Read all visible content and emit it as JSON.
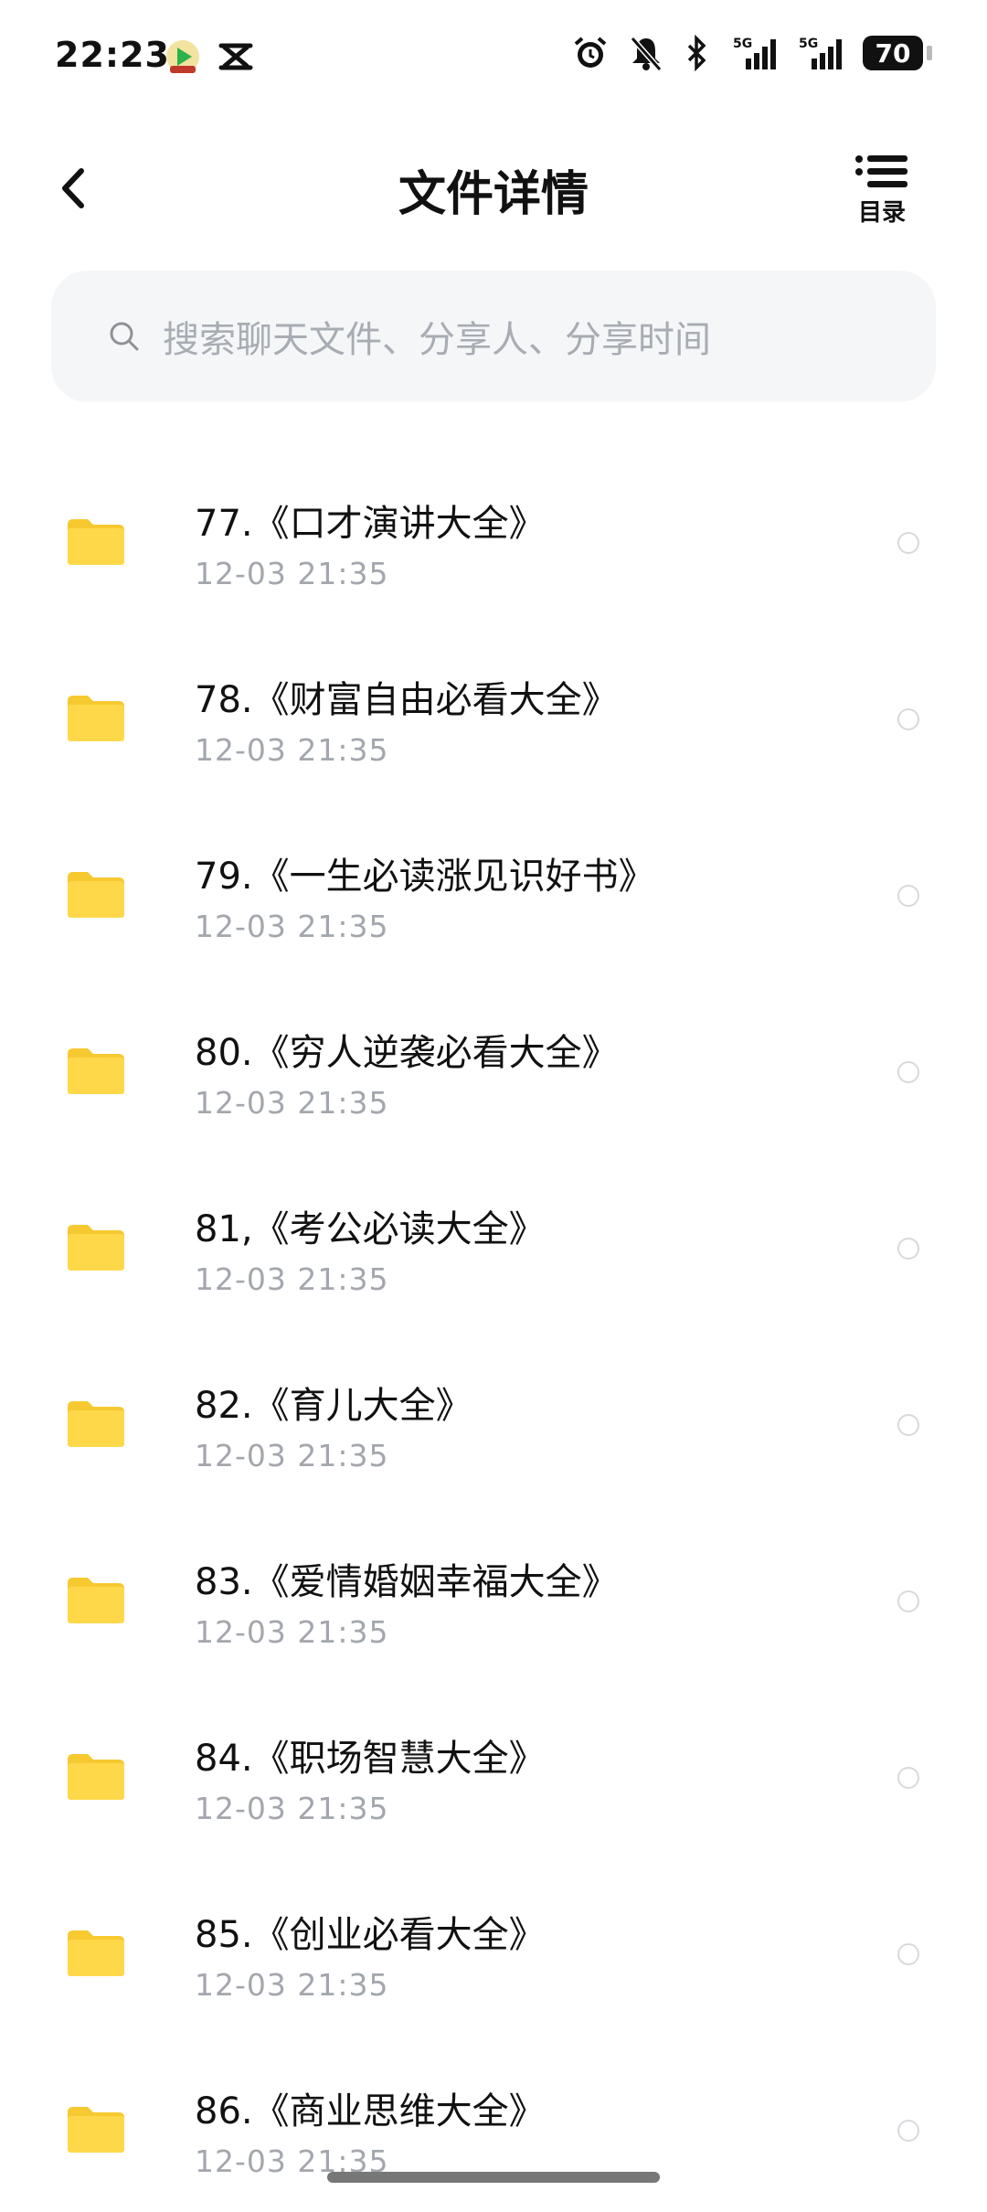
{
  "status_bar": {
    "time": "22:23",
    "battery": "70",
    "signal_label_1": "5G",
    "signal_label_2": "5G",
    "icons": [
      "video-app-icon",
      "capcut-icon",
      "alarm-icon",
      "mute-bell-icon",
      "bluetooth-icon",
      "signal-icon",
      "signal-icon",
      "battery-icon"
    ]
  },
  "header": {
    "title": "文件详情",
    "toc_label": "目录",
    "back_icon": "chevron-left-icon",
    "toc_icon": "list-icon"
  },
  "search": {
    "placeholder": "搜索聊天文件、分享人、分享时间",
    "icon": "search-icon"
  },
  "colors": {
    "folder": "#FFD84A",
    "folder_tab": "#F7C930",
    "search_bg": "#F5F6F8",
    "time_text": "#A3A7AD"
  },
  "files": [
    {
      "name": "77.《口才演讲大全》",
      "time": "12-03  21:35"
    },
    {
      "name": "78.《财富自由必看大全》",
      "time": "12-03  21:35"
    },
    {
      "name": "79.《一生必读涨见识好书》",
      "time": "12-03  21:35"
    },
    {
      "name": "80.《穷人逆袭必看大全》",
      "time": "12-03  21:35"
    },
    {
      "name": "81,《考公必读大全》",
      "time": "12-03  21:35"
    },
    {
      "name": "82.《育儿大全》",
      "time": "12-03  21:35"
    },
    {
      "name": "83.《爱情婚姻幸福大全》",
      "time": "12-03  21:35"
    },
    {
      "name": "84.《职场智慧大全》",
      "time": "12-03  21:35"
    },
    {
      "name": "85.《创业必看大全》",
      "time": "12-03  21:35"
    },
    {
      "name": "86.《商业思维大全》",
      "time": "12-03  21:35"
    }
  ]
}
